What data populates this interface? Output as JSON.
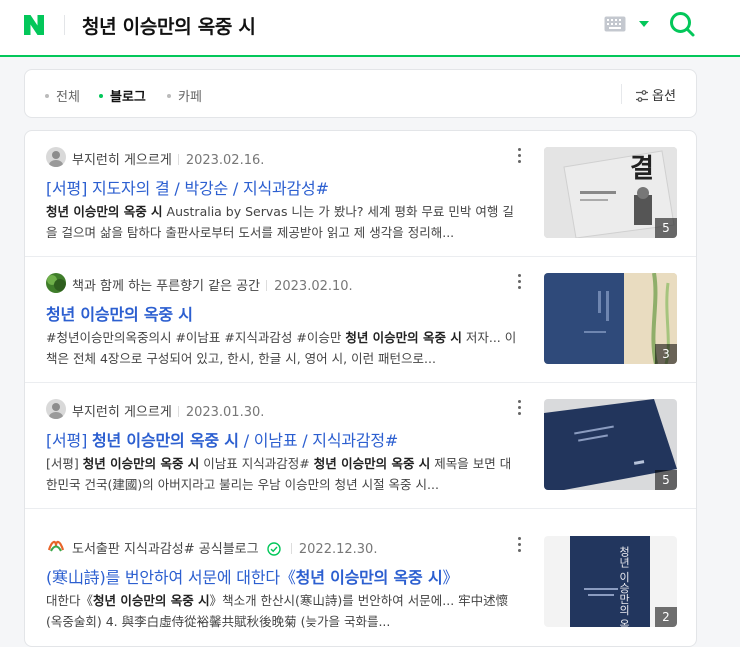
{
  "header": {
    "logo_letter": "N",
    "query": "청년 이승만의 옥중 시",
    "brand_color": "#03c75a"
  },
  "filters": {
    "tabs": [
      {
        "label": "전체",
        "active": false
      },
      {
        "label": "블로그",
        "active": true
      },
      {
        "label": "카페",
        "active": false
      }
    ],
    "options_label": "옵션"
  },
  "results": [
    {
      "author": "부지런히 게으르게",
      "date": "2023.02.16.",
      "verified": false,
      "title": "[서평] 지도자의 결 / 박강순 / 지식과감성#",
      "desc_bold": "청년 이승만의 옥중 시",
      "desc": "Australia by Servas 니는 가 봤나? 세계 평화 무료 민박 여행 길을 걸으며 삶을 탐하다 출판사로부터 도서를 제공받아 읽고 제 생각을 정리해...",
      "image_count": "5",
      "thumb_text": "결"
    },
    {
      "author": "책과 함께 하는 푸른향기 같은 공간",
      "date": "2023.02.10.",
      "verified": false,
      "title": "청년 이승만의 옥중 시",
      "desc_pre": "#청년이승만의옥중의시 #이남표 #지식과감성 #이승만",
      "desc_bold": "청년 이승만의 옥중 시",
      "desc": "저자... 이 책은 전체 4장으로 구성되어 있고, 한시, 한글 시, 영어 시, 이런 패턴으로...",
      "image_count": "3"
    },
    {
      "author": "부지런히 게으르게",
      "date": "2023.01.30.",
      "verified": false,
      "title_pre": "[서평]",
      "title_bold": "청년 이승만의 옥중 시",
      "title_post": "/ 이남표 / 지식과감정#",
      "desc_pre": "[서평]",
      "desc_bold": "청년 이승만의 옥중 시",
      "desc_mid": "이남표 지식과감정#",
      "desc_bold2": "청년 이승만의 옥중 시",
      "desc": "제목을 보면 대한민국 건국(建國)의 아버지라고 불리는 우남 이승만의 청년 시절 옥중 시...",
      "image_count": "5"
    },
    {
      "author": "도서출판 지식과감성# 공식블로그",
      "date": "2022.12.30.",
      "verified": true,
      "title_pre": "(寒山詩)를 번안하여 서문에 대한다《",
      "title_bold": "청년 이승만의 옥중 시",
      "title_post": "》",
      "desc_pre": "대한다《",
      "desc_bold": "청년 이승만의 옥중 시",
      "desc": "》책소개 한산시(寒山詩)를 번안하여 서문에... 牢中述懷 (옥중술회) 4. 與李白虛侍從裕馨共賦秋後晚菊 (늦가을 국화를...",
      "image_count": "2",
      "thumb_text": "청년 이승만의 옥중 시"
    }
  ]
}
